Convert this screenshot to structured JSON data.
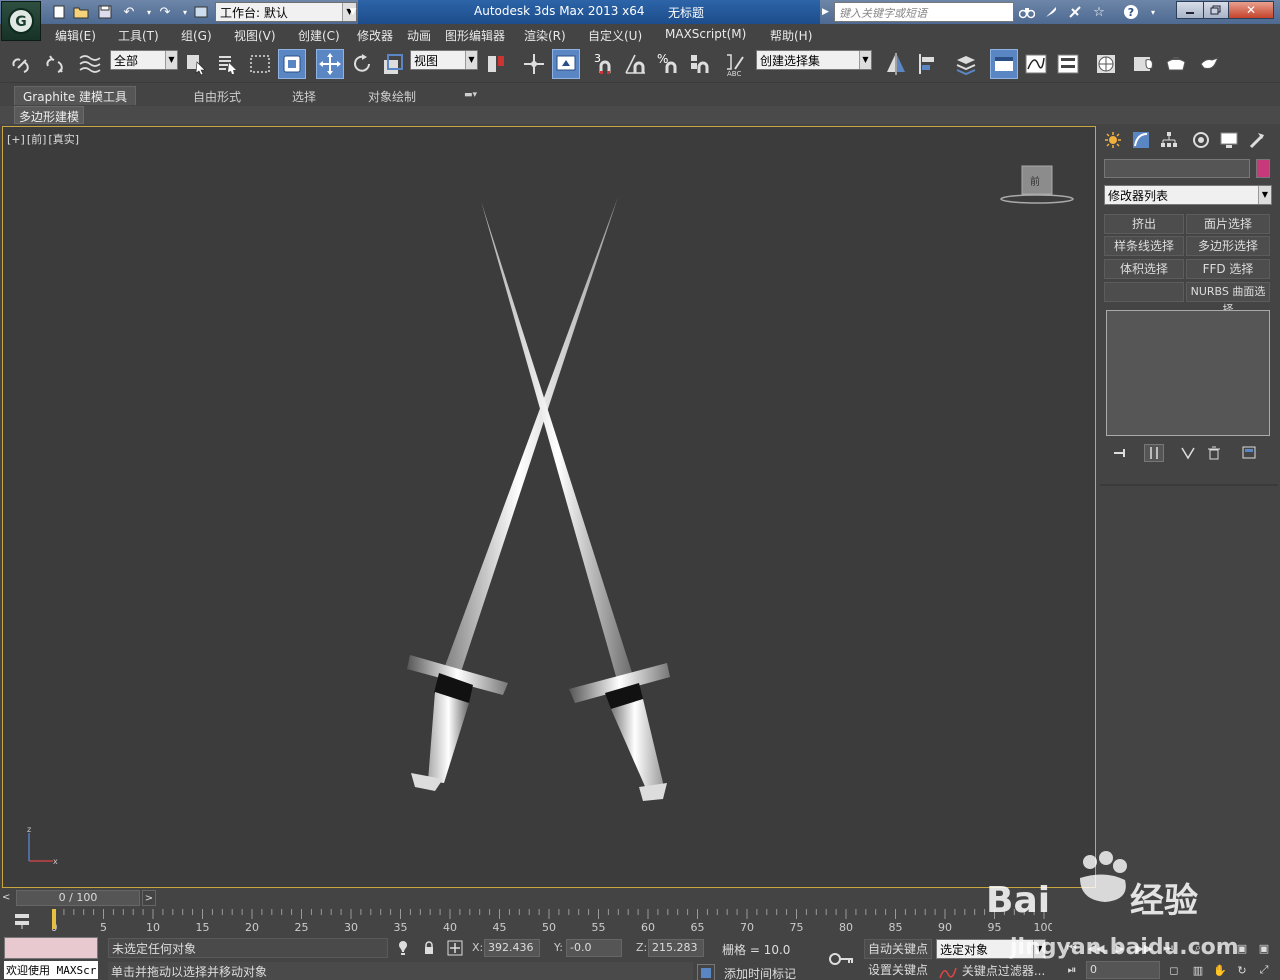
{
  "titlebar": {
    "workspace_label": "工作台: 默认",
    "app_title": "Autodesk 3ds Max  2013 x64",
    "doc_title": "无标题",
    "search_placeholder": "键入关键字或短语"
  },
  "menu": {
    "items": [
      "编辑(E)",
      "工具(T)",
      "组(G)",
      "视图(V)",
      "创建(C)",
      "修改器",
      "动画",
      "图形编辑器",
      "渲染(R)",
      "自定义(U)",
      "MAXScript(M)",
      "帮助(H)"
    ]
  },
  "toolbar": {
    "selection_filter": "全部",
    "ref_coord": "视图",
    "snap_value": "3",
    "named_selection": "创建选择集"
  },
  "ribbon": {
    "tabs": [
      "Graphite 建模工具",
      "自由形式",
      "选择",
      "对象绘制"
    ],
    "sub_tab": "多边形建模"
  },
  "viewport": {
    "label_plus": "[+]",
    "label_view": "[前]",
    "label_shading": "[真实]",
    "viewcube_face": "前"
  },
  "command_panel": {
    "modifier_list": "修改器列表",
    "buttons": [
      "挤出",
      "面片选择",
      "样条线选择",
      "多边形选择",
      "体积选择",
      "FFD 选择",
      "",
      "NURBS 曲面选择"
    ],
    "object_color": "#c63a7a"
  },
  "timeline": {
    "frame_display": "0 / 100",
    "ticks": [
      "0",
      "5",
      "10",
      "15",
      "20",
      "25",
      "30",
      "35",
      "40",
      "45",
      "50",
      "55",
      "60",
      "65",
      "70",
      "75",
      "80",
      "85",
      "90",
      "95",
      "100"
    ]
  },
  "status": {
    "welcome": "欢迎使用 MAXScr",
    "status_line1": "未选定任何对象",
    "status_line2": "单击并拖动以选择并移动对象",
    "x_label": "X:",
    "x_value": "392.436",
    "y_label": "Y:",
    "y_value": "-0.0",
    "z_label": "Z:",
    "z_value": "215.283",
    "grid": "栅格 = 10.0",
    "add_time_tag": "添加时间标记",
    "auto_key": "自动关键点",
    "set_key": "设置关键点",
    "selection_set": "选定对象",
    "key_filters": "关键点过滤器...",
    "frame": "0"
  },
  "watermark": {
    "text": "jingyan.baidu.com"
  }
}
